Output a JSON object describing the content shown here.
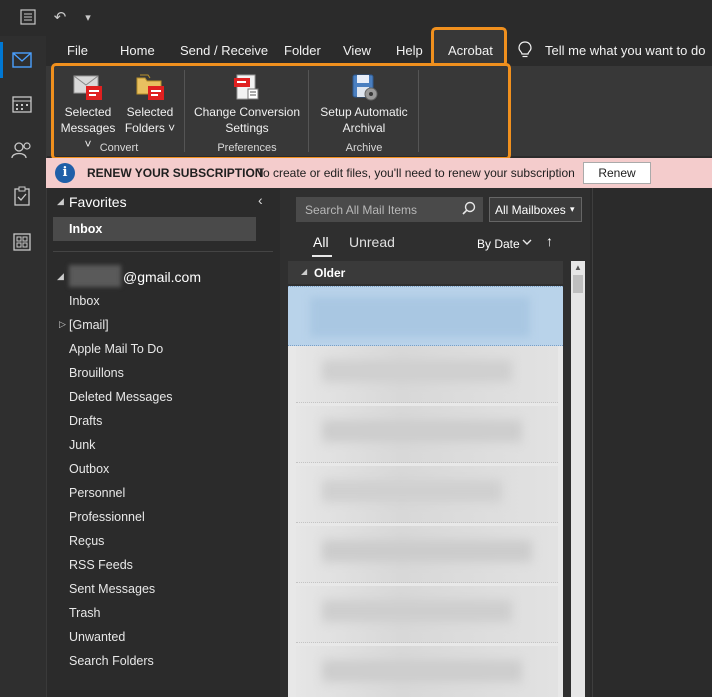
{
  "titlebar": {
    "undo_icon": "undo-icon",
    "customize_icon": "customize-icon"
  },
  "tabs": [
    {
      "label": "File"
    },
    {
      "label": "Home"
    },
    {
      "label": "Send / Receive"
    },
    {
      "label": "Folder"
    },
    {
      "label": "View"
    },
    {
      "label": "Help"
    },
    {
      "label": "Acrobat"
    }
  ],
  "tell_me": "Tell me what you want to do",
  "ribbon": {
    "convert": {
      "selected_messages": [
        "Selected",
        "Messages ˅"
      ],
      "selected_folders": [
        "Selected",
        "Folders ˅"
      ],
      "label": "Convert"
    },
    "preferences": {
      "change_settings": [
        "Change Conversion",
        "Settings"
      ],
      "label": "Preferences"
    },
    "archive": {
      "setup": [
        "Setup Automatic",
        "Archival"
      ],
      "label": "Archive"
    }
  },
  "banner": {
    "title": "RENEW YOUR SUBSCRIPTION",
    "message": "To create or edit files, you'll need to renew your subscription",
    "button": "Renew"
  },
  "folderpane": {
    "favorites_label": "Favorites",
    "favorites_inbox": "Inbox",
    "account": "@gmail.com",
    "folders": [
      "Inbox",
      "[Gmail]",
      "Apple Mail To Do",
      "Brouillons",
      "Deleted Messages",
      "Drafts",
      "Junk",
      "Outbox",
      "Personnel",
      "Professionnel",
      "Reçus",
      "RSS Feeds",
      "Sent Messages",
      "Trash",
      "Unwanted",
      "Search Folders"
    ]
  },
  "list": {
    "search_placeholder": "Search All Mail Items",
    "scope": "All Mailboxes",
    "filter_all": "All",
    "filter_unread": "Unread",
    "sort": "By Date",
    "group_header": "Older"
  },
  "colors": {
    "accent": "#0078d4",
    "highlight": "#f0901e",
    "banner_bg": "#f4cccc"
  }
}
